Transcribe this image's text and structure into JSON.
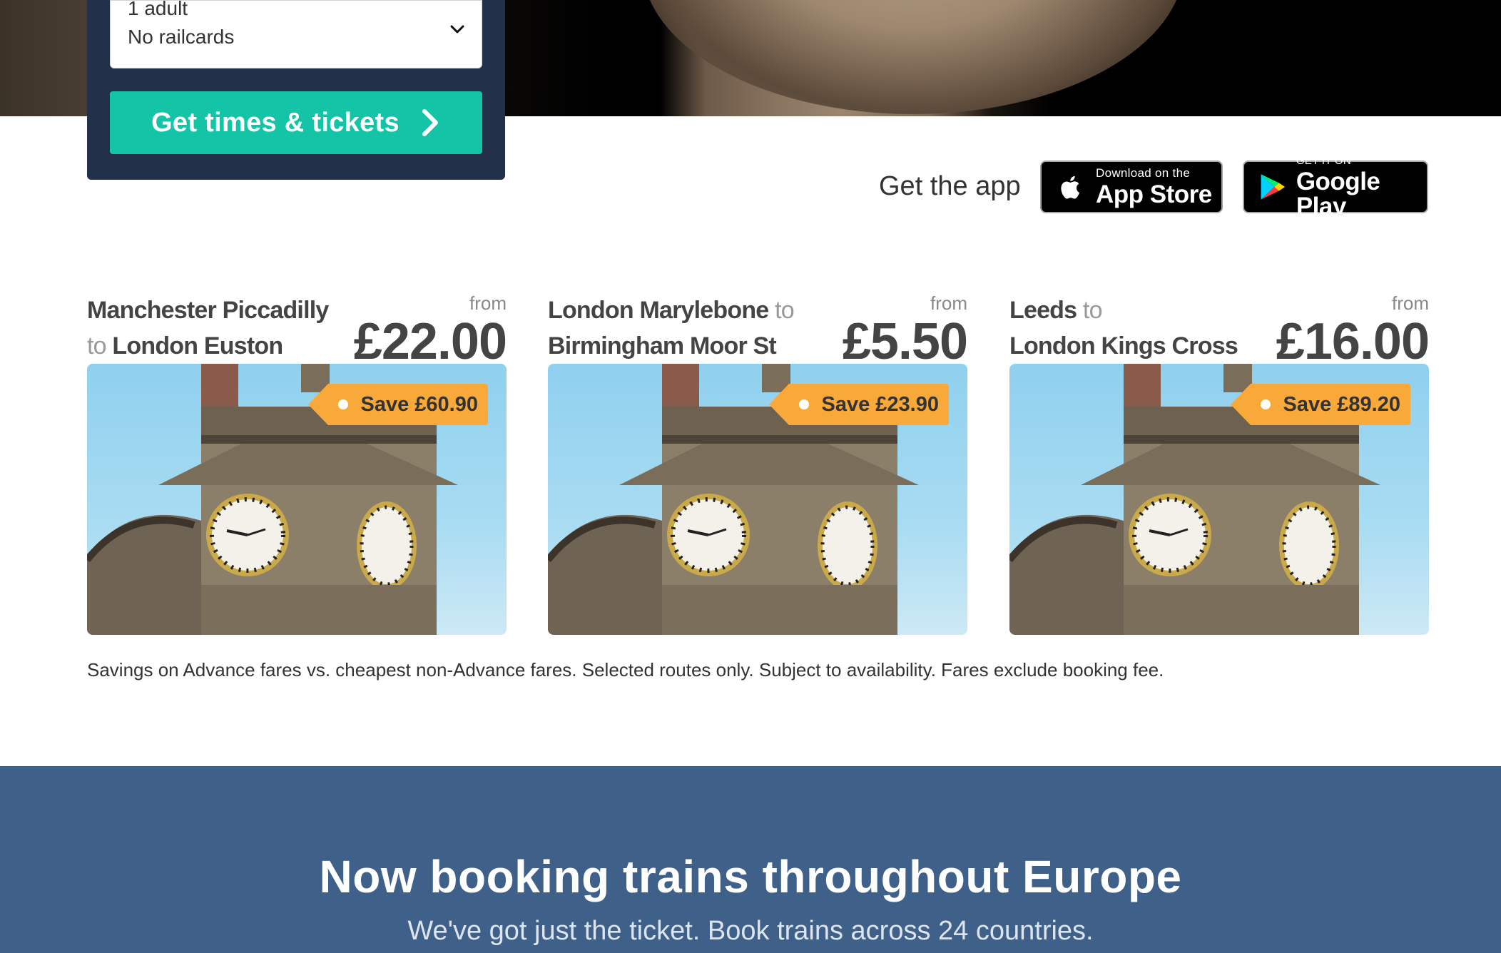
{
  "search": {
    "passengers_line1": "1 adult",
    "passengers_line2": "No railcards",
    "cta_label": "Get times & tickets"
  },
  "app": {
    "label": "Get the app",
    "app_store_small": "Download on the",
    "app_store_big": "App Store",
    "google_small": "GET IT ON",
    "google_big": "Google Play"
  },
  "deals": [
    {
      "origin": "Manchester Piccadilly",
      "connector": "to",
      "destination": "London Euston",
      "from_label": "from",
      "price": "£22.00",
      "save": "Save £60.90"
    },
    {
      "origin": "London Marylebone",
      "connector": "to",
      "destination": "Birmingham Moor St",
      "from_label": "from",
      "price": "£5.50",
      "save": "Save £23.90"
    },
    {
      "origin": "Leeds",
      "connector": "to",
      "destination": "London Kings Cross",
      "from_label": "from",
      "price": "£16.00",
      "save": "Save £89.20"
    }
  ],
  "disclaimer": "Savings on Advance fares vs. cheapest non-Advance fares. Selected routes only. Subject to availability. Fares exclude booking fee.",
  "europe": {
    "title": "Now booking trains throughout Europe",
    "subtitle": "We've got just the ticket. Book trains across 24 countries."
  },
  "colors": {
    "panel": "#22304a",
    "cta": "#14c4a6",
    "save_tag": "#f8a93a",
    "banner": "#3f6088"
  }
}
